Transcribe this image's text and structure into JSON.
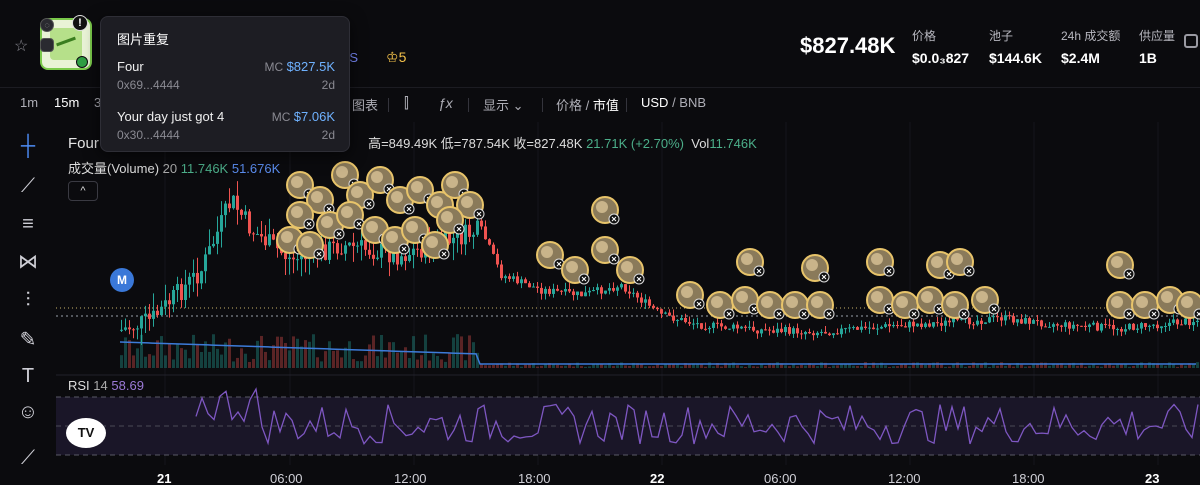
{
  "header": {
    "big_price": "$827.48K",
    "ds_tag": "DS",
    "crown_count": "5",
    "stats": [
      {
        "key": "价格",
        "value": "$0.0₃827"
      },
      {
        "key": "池子",
        "value": "$144.6K"
      },
      {
        "key": "24h 成交额",
        "value": "$2.4M"
      },
      {
        "key": "供应量",
        "value": "1B"
      }
    ]
  },
  "toolbar": {
    "intervals": [
      "1m",
      "15m",
      "3"
    ],
    "active_interval": "15m",
    "chart_label": "图表",
    "display_label": "显示",
    "price_label": "价格",
    "mcap_label": "市值",
    "usd_label": "USD",
    "bnb_label": "BNB"
  },
  "tooltip": {
    "title": "图片重复",
    "rows": [
      {
        "name": "Four",
        "addr": "0x69...4444",
        "mc_label": "MC",
        "mc_value": "$827.5K",
        "age": "2d"
      },
      {
        "name": "Your day just got 4",
        "addr": "0x30...4444",
        "mc_label": "MC",
        "mc_value": "$7.06K",
        "age": "2d"
      }
    ]
  },
  "legend": {
    "symbol": "Four",
    "high": "高=849.49K",
    "low": "低=787.54K",
    "close": "收=827.48K",
    "change": "21.71K (+2.70%)",
    "vol_label": "Vol",
    "vol_value": "11.746K",
    "volume_label": "成交量(Volume)",
    "volume_period": "20",
    "volume_v1": "11.746K",
    "volume_v2": "51.676K",
    "rsi_label": "RSI",
    "rsi_period": "14",
    "rsi_value": "58.69",
    "marker_letter": "M",
    "tv_logo": "TV"
  },
  "colors": {
    "up": "#26a69a",
    "down": "#ef5350",
    "rsi": "#7e57c2",
    "vol_ma": "#3d7bd9",
    "accent_blue": "#6fb2ff"
  },
  "icons": [
    "star-icon",
    "crosshair-icon",
    "trendline-icon",
    "horizontal-lines-icon",
    "pattern-icon",
    "fib-icon",
    "brush-icon",
    "text-icon",
    "emoji-icon",
    "ruler-icon",
    "candle-type-icon",
    "indicator-icon",
    "external-icon"
  ],
  "chart_data": {
    "type": "candlestick",
    "x_ticks": [
      "21",
      "06:00",
      "12:00",
      "18:00",
      "22",
      "06:00",
      "12:00",
      "18:00",
      "23"
    ],
    "rsi_levels": [
      70,
      50,
      30
    ],
    "current_value": "827.48K"
  }
}
